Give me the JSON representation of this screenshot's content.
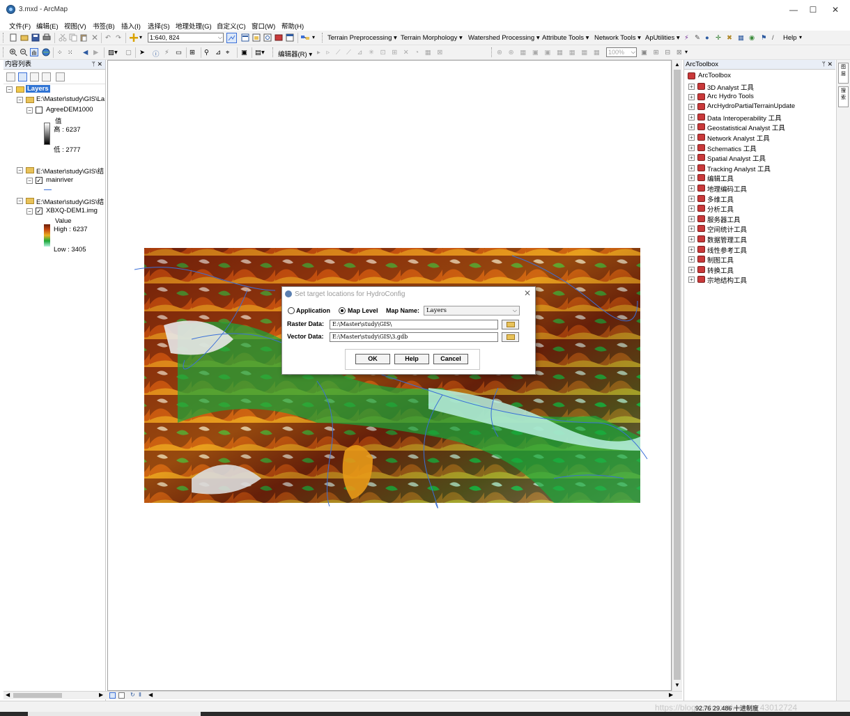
{
  "window": {
    "title": "3.mxd - ArcMap",
    "controls": [
      "—",
      "☐",
      "✕"
    ]
  },
  "menubar": [
    "文件(F)",
    "编辑(E)",
    "视图(V)",
    "书签(B)",
    "插入(I)",
    "选择(S)",
    "地理处理(G)",
    "自定义(C)",
    "窗口(W)",
    "帮助(H)"
  ],
  "toolbar1": {
    "scale": "1:640, 824",
    "hydro_menus": [
      "Terrain Preprocessing ▾",
      "Terrain Morphology ▾",
      "Watershed Processing ▾",
      "Attribute Tools ▾",
      "Network Tools ▾",
      "ApUtilities ▾"
    ],
    "help": "Help"
  },
  "toolbar2": {
    "editor": "编辑器(R) ▾",
    "zoom": "100%"
  },
  "toc": {
    "title": "内容列表",
    "pin": "ᛘ ✕",
    "root": "Layers",
    "groups": [
      {
        "path": "E:\\Master\\study\\GIS\\La",
        "layer": "AgreeDEM1000",
        "checked": false,
        "legend_title": "值",
        "high": "高 : 6237",
        "low": "低 : 2777"
      },
      {
        "path": "E:\\Master\\study\\GIS\\结",
        "layer": "mainriver",
        "checked": true
      },
      {
        "path": "E:\\Master\\study\\GIS\\结",
        "layer": "XBXQ-DEM1.img",
        "checked": true,
        "legend_title": "Value",
        "high": "High : 6237",
        "low": "Low : 3405"
      }
    ]
  },
  "toolbox": {
    "title": "ArcToolbox",
    "pin": "ᛘ ✕",
    "root": "ArcToolbox",
    "items": [
      "3D Analyst 工具",
      "Arc Hydro Tools",
      "ArcHydroPartialTerrainUpdate",
      "Data Interoperability 工具",
      "Geostatistical Analyst 工具",
      "Network Analyst 工具",
      "Schematics 工具",
      "Spatial Analyst 工具",
      "Tracking Analyst 工具",
      "编辑工具",
      "地理编码工具",
      "多维工具",
      "分析工具",
      "服务器工具",
      "空间统计工具",
      "数据管理工具",
      "线性参考工具",
      "制图工具",
      "转换工具",
      "宗地结构工具"
    ]
  },
  "side_tabs": [
    "图层",
    "搜索"
  ],
  "dialog": {
    "title": "Set target locations for HydroConfig",
    "close": "✕",
    "radio_application": "Application",
    "radio_maplevel": "Map Level",
    "selected": "Map Level",
    "map_name_label": "Map Name:",
    "map_name_value": "Layers",
    "raster_label": "Raster Data:",
    "raster_value": "E:\\Master\\study\\GIS\\",
    "vector_label": "Vector Data:",
    "vector_value": "E:\\Master\\study\\GIS\\3.gdb",
    "ok": "OK",
    "help": "Help",
    "cancel": "Cancel"
  },
  "status": {
    "coords": "92.76  29.486 十进制度",
    "watermark": "https://blog.csdn.net/weixin_43012724"
  },
  "colors": {
    "accent": "#3074d4",
    "dem_high": "#6b1f0a",
    "dem_mid": "#e07a10",
    "dem_low": "#1aa83a",
    "river": "#3a6fd8"
  }
}
